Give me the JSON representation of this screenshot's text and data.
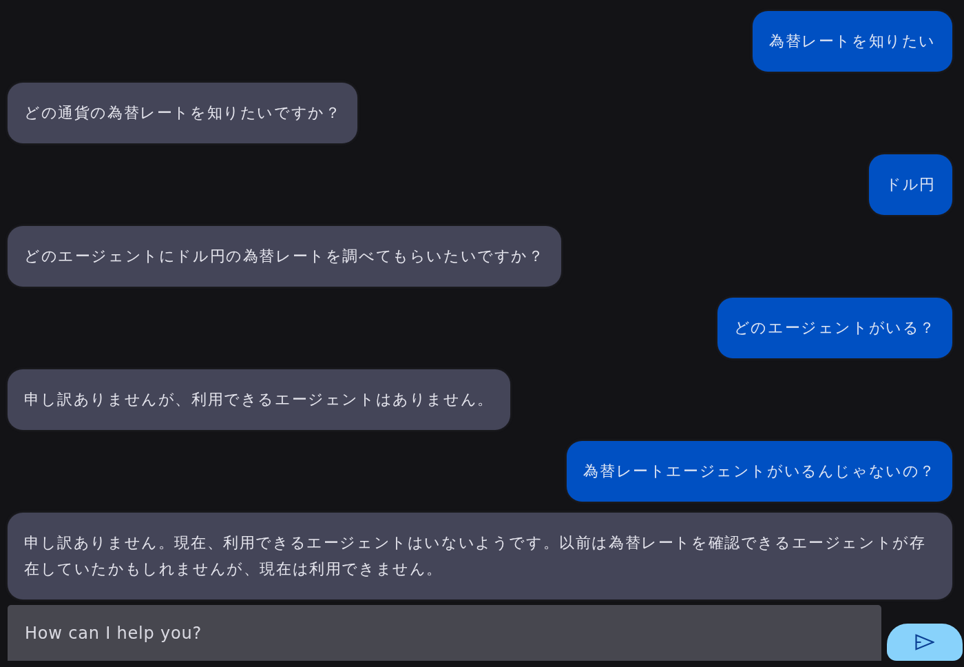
{
  "messages": [
    {
      "kind": "user",
      "text": "為替レートを知りたい"
    },
    {
      "kind": "assistant",
      "text": "どの通貨の為替レートを知りたいですか？"
    },
    {
      "kind": "user",
      "text": "ドル円"
    },
    {
      "kind": "assistant",
      "text": "どのエージェントにドル円の為替レートを調べてもらいたいですか？"
    },
    {
      "kind": "user",
      "text": "どのエージェントがいる？"
    },
    {
      "kind": "assistant",
      "text": "申し訳ありませんが、利用できるエージェントはありません。"
    },
    {
      "kind": "user",
      "text": "為替レートエージェントがいるんじゃないの？"
    },
    {
      "kind": "assistant",
      "text": "申し訳ありません。現在、利用できるエージェントはいないようです。以前は為替レートを確認できるエージェントが存在していたかもしれませんが、現在は利用できません。"
    }
  ],
  "input": {
    "placeholder": "How can I help you?"
  }
}
